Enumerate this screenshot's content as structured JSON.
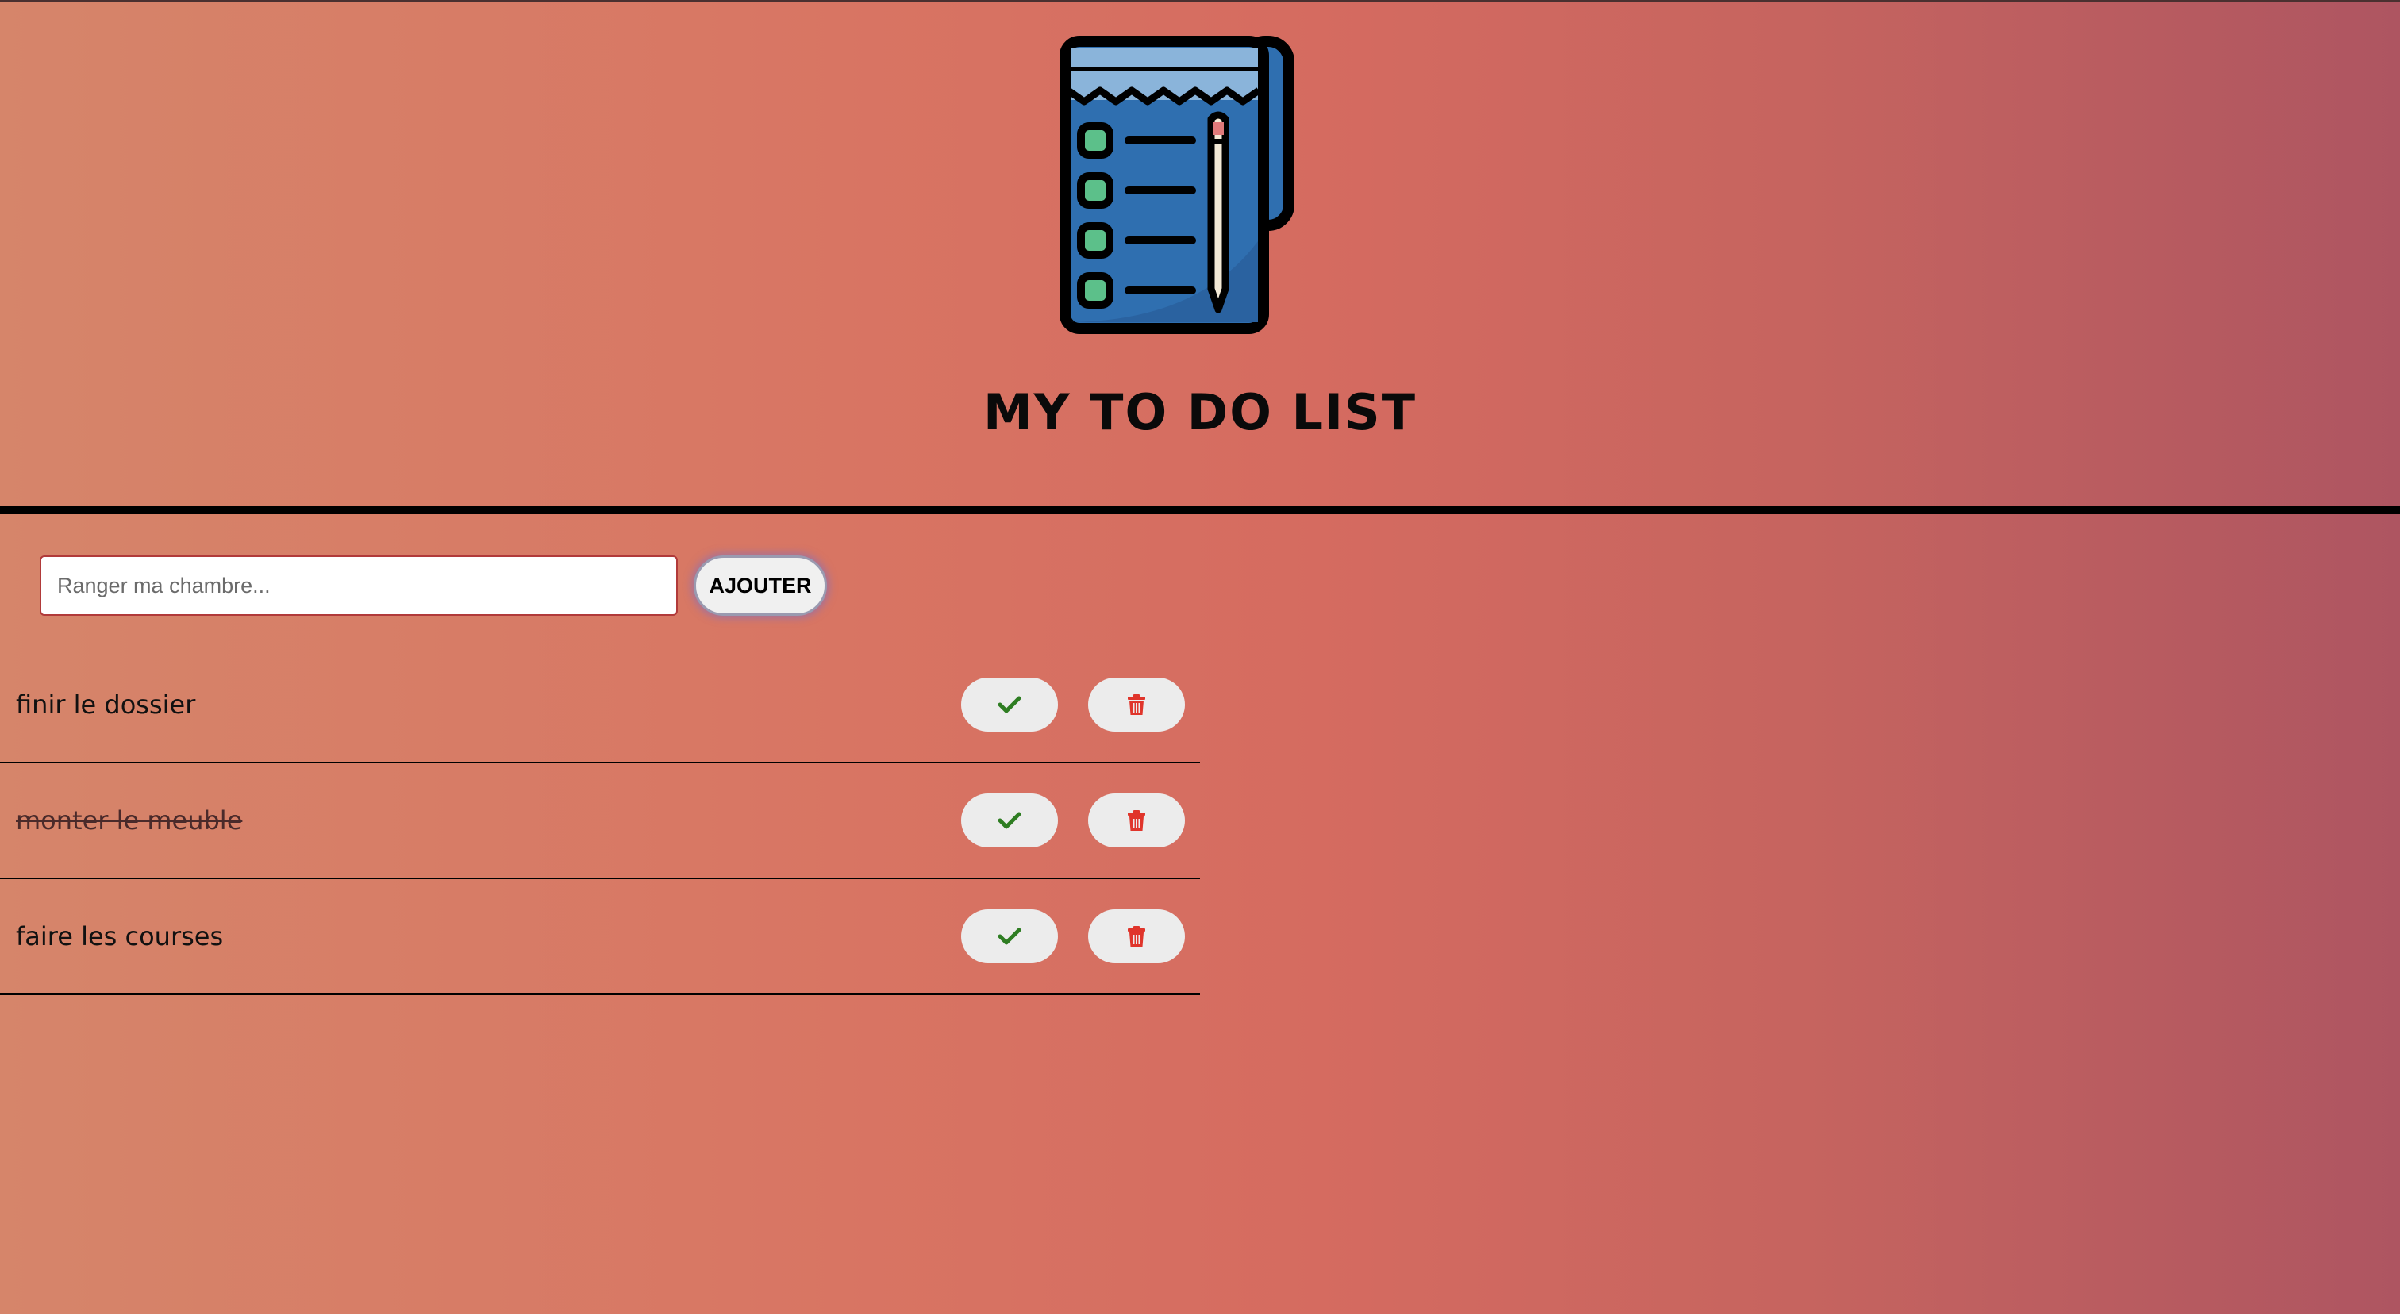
{
  "header": {
    "logo_icon": "notepad-checklist-icon",
    "title": "MY TO DO LIST"
  },
  "form": {
    "input_placeholder": "Ranger ma chambre...",
    "input_value": "",
    "add_label": "AJOUTER"
  },
  "todos": [
    {
      "text": "finir le dossier",
      "done": false,
      "check_icon": "check-icon",
      "delete_icon": "trash-icon"
    },
    {
      "text": "monter le meuble",
      "done": true,
      "check_icon": "check-icon",
      "delete_icon": "trash-icon"
    },
    {
      "text": "faire les courses",
      "done": false,
      "check_icon": "check-icon",
      "delete_icon": "trash-icon"
    }
  ],
  "colors": {
    "check": "#2e7d22",
    "trash": "#e0352b",
    "button_bg": "#ececec",
    "divider": "#000000"
  }
}
